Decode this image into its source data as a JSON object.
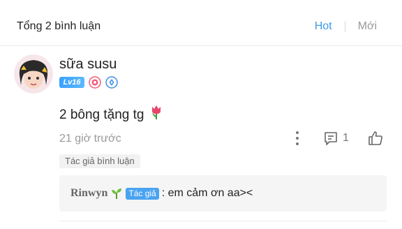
{
  "header": {
    "title": "Tổng 2 bình luận",
    "sort_tabs": [
      {
        "label": "Hot",
        "active": true,
        "color": "#3d9ae8"
      },
      {
        "label": "Mới",
        "active": false
      }
    ]
  },
  "comment": {
    "username": "sữa susu",
    "level_badge": "Lv16",
    "text": "2 bông tặng tg",
    "text_emoji_icon": "tulip-icon",
    "timestamp": "21 giờ trước",
    "reply_count": "1",
    "author_tag": "Tác giả bình luận",
    "actions": [
      "more-options-icon",
      "reply-icon",
      "like-icon"
    ]
  },
  "reply": {
    "author": "Rinwyn",
    "author_icon": "sprout-icon",
    "author_badge": "Tác giả",
    "text": ": em cảm ơn aa><"
  }
}
